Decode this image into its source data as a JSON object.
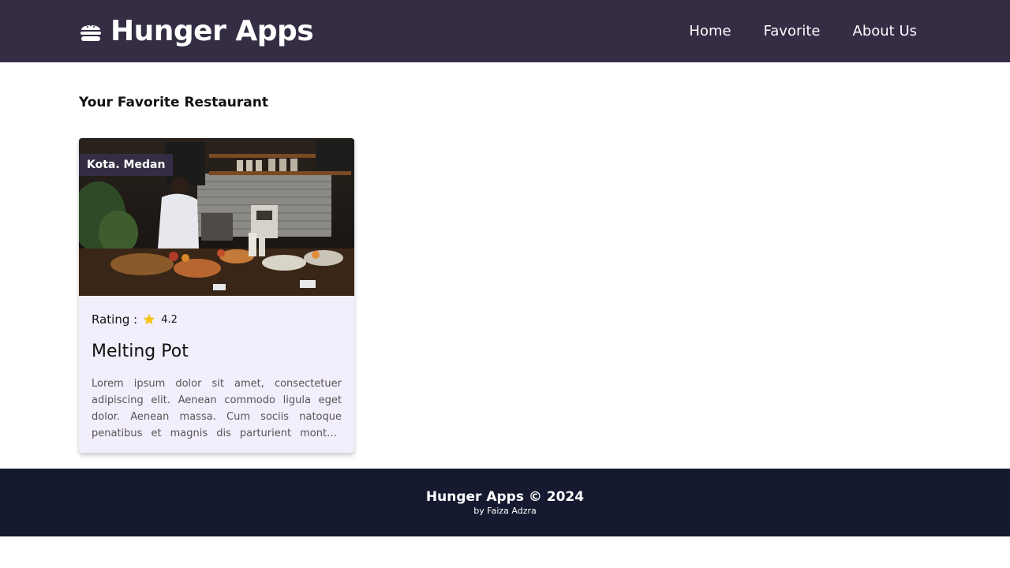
{
  "header": {
    "app_title": "Hunger Apps",
    "brand_icon": "burger-icon",
    "nav": [
      {
        "label": "Home"
      },
      {
        "label": "Favorite"
      },
      {
        "label": "About Us"
      }
    ]
  },
  "main": {
    "page_title": "Your Favorite Restaurant",
    "restaurants": [
      {
        "city": "Kota. Medan",
        "rating_label": "Rating :",
        "rating_icon": "star-icon",
        "rating": "4.2",
        "name": "Melting Pot",
        "description": "Lorem ipsum dolor sit amet, consectetuer adipiscing elit. Aenean commodo ligula eget dolor. Aenean massa. Cum sociis natoque penatibus et magnis dis parturient montes, nascetur ridiculus mus.",
        "image": "restaurant-kitchen-photo"
      }
    ]
  },
  "footer": {
    "title": "Hunger Apps © 2024",
    "credit": "by Faiza Adzra"
  },
  "colors": {
    "header_bg": "#342d44",
    "footer_bg": "#151a30",
    "card_bg": "#f3eefb",
    "star": "#f5c518"
  }
}
